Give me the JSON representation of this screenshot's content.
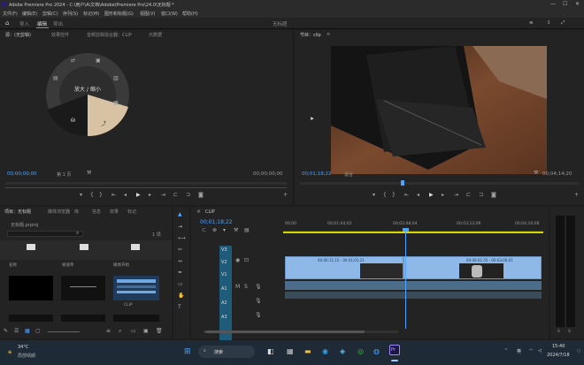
{
  "title_bar": {
    "title": "Adobe Premiere Pro 2024 - C:\\用户\\A\\文档\\Adobe\\Premiere Pro\\24.0\\无标题 *"
  },
  "menu": [
    "文件(F)",
    "编辑(E)",
    "剪辑(C)",
    "序列(S)",
    "标记(M)",
    "图形和标题(G)",
    "视图(V)",
    "窗口(W)",
    "帮助(H)"
  ],
  "workspace": {
    "tabs": [
      "导入",
      "编辑",
      "导出"
    ],
    "doc_title": "无标题"
  },
  "source_panel": {
    "tabs": [
      "源：(无剪辑)",
      "效果控件",
      "音频剪辑混合器：CLIP",
      "元数据"
    ],
    "radial_label": "放大 / 缩小",
    "timecode_left": "00;00;00;00",
    "page_indicator": "第 1 页",
    "timecode_right": "00;00;00;00"
  },
  "program_panel": {
    "tabs": [
      "节目：clip",
      "≡"
    ],
    "timecode_left": "00;01;18;22",
    "fit_label": "适合",
    "timecode_right": "00;04;14;20"
  },
  "project_panel": {
    "tabs": [
      "项目：无标题",
      "媒体浏览器",
      "库",
      "信息",
      "效果",
      "标记"
    ],
    "project_file": "无标题.prproj",
    "item_count": "1 项",
    "search_placeholder": "",
    "thumb_labels": [
      "",
      "CLIP",
      "其他剪辑文件"
    ],
    "col_labels": [
      "名称",
      "帧速率",
      "媒体开始"
    ]
  },
  "timeline_panel": {
    "sequence_tab": "CLIP",
    "timecode": "00;01;18;22",
    "ruler_marks": [
      "00;00",
      "00;01;04;02",
      "00;02;08;04",
      "00;03;12;06",
      "00;04;16;08"
    ],
    "tracks_video": [
      "V3",
      "V2",
      "V1"
    ],
    "tracks_audio": [
      "A1",
      "A2",
      "A3"
    ],
    "clip_labels": [
      "00:00:11;15 - 00:01;01;21",
      "00:00:01;55 - 00:03;00;01"
    ]
  },
  "taskbar": {
    "weather_temp": "34°C",
    "weather_desc": "局部晴朗",
    "search_label": "搜索",
    "time": "15:40",
    "date": "2024/7/18"
  }
}
